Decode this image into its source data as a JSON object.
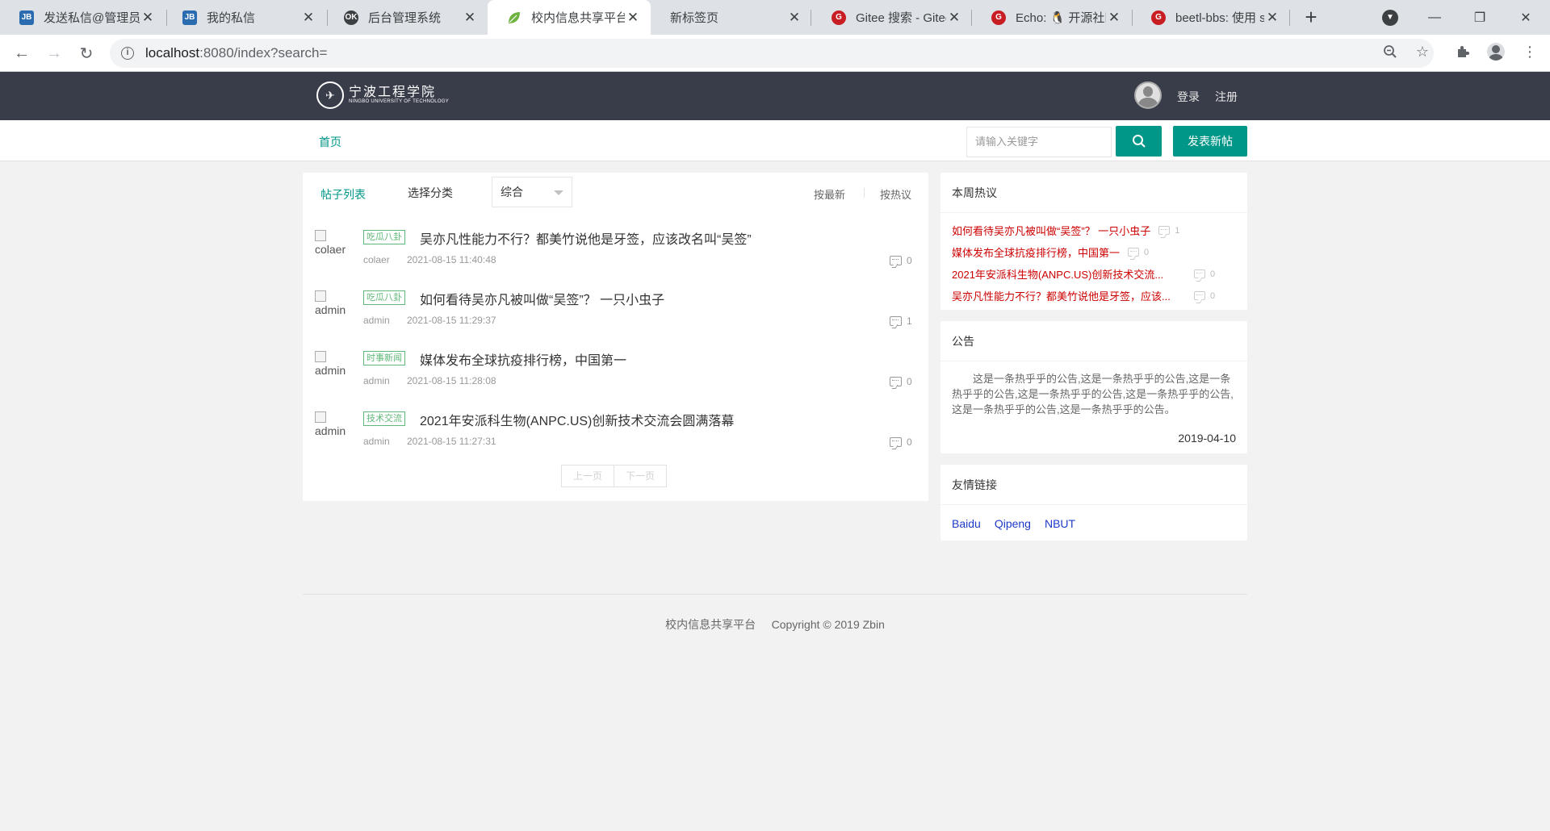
{
  "browser": {
    "tabs": [
      {
        "title": "发送私信@管理员",
        "icon": "site-logo-icon"
      },
      {
        "title": "我的私信",
        "icon": "site-logo-icon"
      },
      {
        "title": "后台管理系统",
        "icon": "ok-icon"
      },
      {
        "title": "校内信息共享平台",
        "icon": "leaf-icon"
      },
      {
        "title": "新标签页",
        "icon": ""
      },
      {
        "title": "Gitee 搜索 - Gitee",
        "icon": "gitee-icon"
      },
      {
        "title": "Echo: 🐧 开源社区",
        "icon": "gitee-icon"
      },
      {
        "title": "beetl-bbs: 使用 s",
        "icon": "gitee-icon"
      }
    ],
    "url_host": "localhost",
    "url_rest": ":8080/index?search=",
    "colors": {
      "tabbar": "#dee1e6",
      "active_tab": "#ffffff",
      "omnibox": "#f1f3f4"
    }
  },
  "header": {
    "logo_cn": "宁波工程学院",
    "logo_en": "NINGBO UNIVERSITY OF TECHNOLOGY",
    "login_label": "登录",
    "register_label": "注册"
  },
  "subnav": {
    "home_label": "首页",
    "search_placeholder": "请输入关键字",
    "post_button_label": "发表新帖"
  },
  "post_list": {
    "title": "帖子列表",
    "category_label": "选择分类",
    "category_value": "综合",
    "sort_latest": "按最新",
    "sort_hot": "按热议",
    "posts": [
      {
        "avatar_alt": "colaer",
        "category": "吃瓜八卦",
        "title": "吴亦凡性能力不行？都美竹说他是牙签，应该改名叫“吴签”",
        "author": "colaer",
        "time": "2021-08-15 11:40:48",
        "replies": "0"
      },
      {
        "avatar_alt": "admin",
        "category": "吃瓜八卦",
        "title": "如何看待吴亦凡被叫做“吴签”？ 一只小虫子",
        "author": "admin",
        "time": "2021-08-15 11:29:37",
        "replies": "1"
      },
      {
        "avatar_alt": "admin",
        "category": "时事新闻",
        "title": "媒体发布全球抗疫排行榜，中国第一",
        "author": "admin",
        "time": "2021-08-15 11:28:08",
        "replies": "0"
      },
      {
        "avatar_alt": "admin",
        "category": "技术交流",
        "title": "2021年安派科生物(ANPC.US)创新技术交流会圆满落幕",
        "author": "admin",
        "time": "2021-08-15 11:27:31",
        "replies": "0"
      }
    ],
    "prev_label": "上一页",
    "next_label": "下一页"
  },
  "hot": {
    "title": "本周热议",
    "items": [
      {
        "title": "如何看待吴亦凡被叫做“吴签”？ 一只小虫子",
        "count": "1"
      },
      {
        "title": "媒体发布全球抗疫排行榜，中国第一",
        "count": "0"
      },
      {
        "title": "2021年安派科生物(ANPC.US)创新技术交流...",
        "count": "0"
      },
      {
        "title": "吴亦凡性能力不行？都美竹说他是牙签，应该...",
        "count": "0"
      }
    ]
  },
  "notice": {
    "title": "公告",
    "body": "这是一条热乎乎的公告,这是一条热乎乎的公告,这是一条热乎乎的公告,这是一条热乎乎的公告,这是一条热乎乎的公告,这是一条热乎乎的公告,这是一条热乎乎的公告。",
    "date": "2019-04-10"
  },
  "links": {
    "title": "友情链接",
    "items": [
      "Baidu",
      "Qipeng",
      "NBUT"
    ]
  },
  "footer": {
    "site": "校内信息共享平台",
    "copyright": "Copyright © 2019 Zbin"
  },
  "theme": {
    "primary": "#009688",
    "header_bg": "#393d49",
    "hot_link": "#cc0000",
    "badge": "#5FB878"
  }
}
